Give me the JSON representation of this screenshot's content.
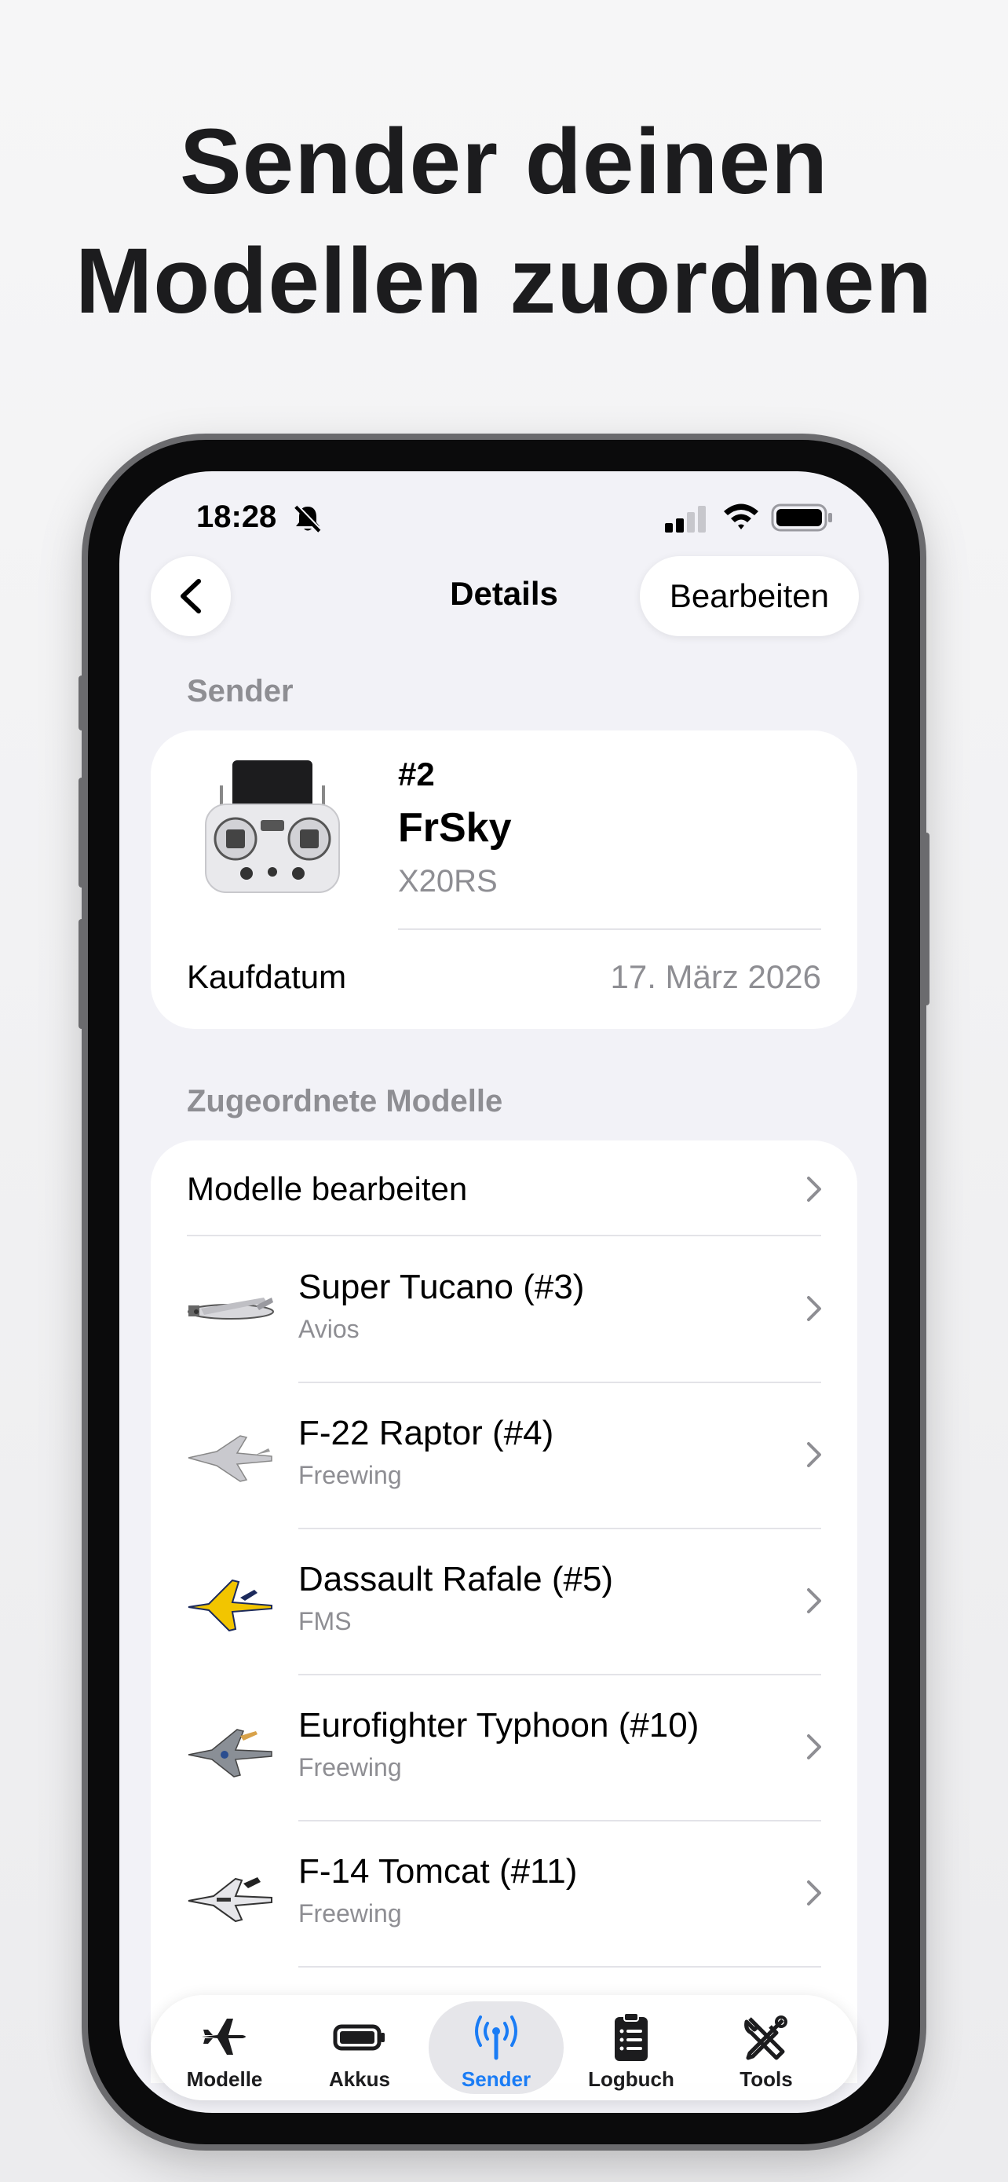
{
  "headline": {
    "line1": "Sender deinen",
    "line2": "Modellen zuordnen"
  },
  "status_bar": {
    "time": "18:28",
    "icons": [
      "bell-slash-icon",
      "signal-icon",
      "wifi-icon",
      "battery-icon"
    ]
  },
  "nav": {
    "title": "Details",
    "edit_label": "Bearbeiten",
    "back_icon": "chevron-left-icon"
  },
  "sender_section": {
    "header": "Sender",
    "number": "#2",
    "brand": "FrSky",
    "model": "X20RS",
    "purchase_label": "Kaufdatum",
    "purchase_date": "17. März 2026"
  },
  "models_section": {
    "header": "Zugeordnete Modelle",
    "edit_row_label": "Modelle bearbeiten",
    "items": [
      {
        "name": "Super Tucano (#3)",
        "maker": "Avios"
      },
      {
        "name": "F-22 Raptor (#4)",
        "maker": "Freewing"
      },
      {
        "name": "Dassault Rafale (#5)",
        "maker": "FMS"
      },
      {
        "name": "Eurofighter Typhoon (#10)",
        "maker": "Freewing"
      },
      {
        "name": "F-14 Tomcat (#11)",
        "maker": "Freewing"
      }
    ]
  },
  "tabbar": {
    "active_color": "#1a7cf5",
    "tabs": [
      {
        "label": "Modelle",
        "icon": "airplane-icon"
      },
      {
        "label": "Akkus",
        "icon": "battery-icon"
      },
      {
        "label": "Sender",
        "icon": "antenna-icon",
        "active": true
      },
      {
        "label": "Logbuch",
        "icon": "clipboard-icon"
      },
      {
        "label": "Tools",
        "icon": "tools-icon"
      }
    ]
  }
}
